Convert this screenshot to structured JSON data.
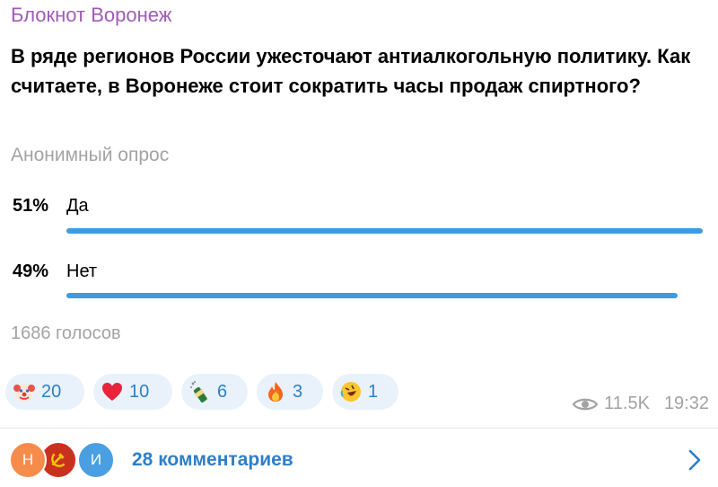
{
  "channel": {
    "name": "Блокнот Воронеж"
  },
  "poll": {
    "question": "В ряде регионов России ужесточают антиалкогольную политику. Как считаете, в Воронеже стоит сократить часы продаж спиртного?",
    "type_label": "Анонимный опрос",
    "options": [
      {
        "percent_label": "51%",
        "label": "Да",
        "fraction": 0.51
      },
      {
        "percent_label": "49%",
        "label": "Нет",
        "fraction": 0.49
      }
    ],
    "votes_label": "1686 голосов",
    "bar_color": "#3d9be0"
  },
  "reactions": [
    {
      "icon": "clown-face-icon",
      "count": "20"
    },
    {
      "icon": "red-heart-icon",
      "count": "10"
    },
    {
      "icon": "champagne-bottle-icon",
      "count": "6"
    },
    {
      "icon": "fire-icon",
      "count": "3"
    },
    {
      "icon": "rofl-face-icon",
      "count": "1"
    }
  ],
  "meta": {
    "views": "11.5K",
    "time": "19:32"
  },
  "comments": {
    "avatars": [
      {
        "letter": "Н",
        "color": "#f58c4b"
      },
      {
        "letter": "",
        "color": "#c9311f"
      },
      {
        "letter": "И",
        "color": "#4a9fe3"
      }
    ],
    "label": "28 комментариев"
  },
  "colors": {
    "accent": "#2e7fc7",
    "channel_name": "#a05bb8",
    "muted": "#a3a3a3"
  }
}
